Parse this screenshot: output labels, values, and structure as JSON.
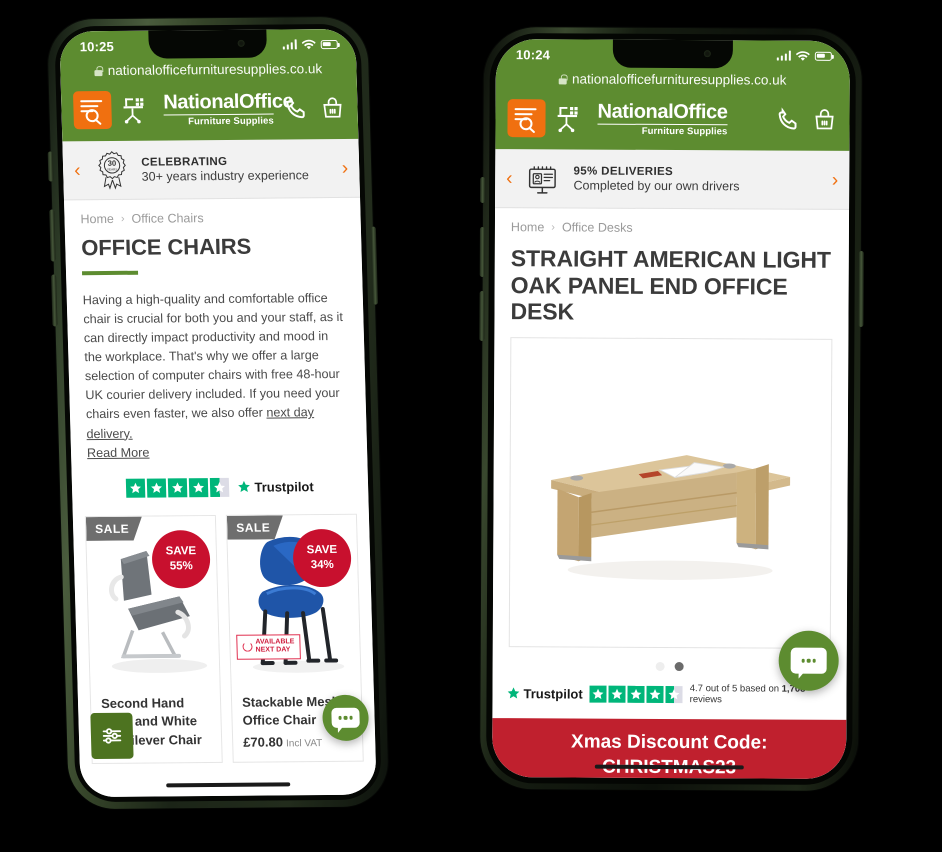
{
  "background_color": "#000000",
  "brand": {
    "green": "#5d8c30",
    "orange": "#f07010",
    "red": "#c8102e",
    "trustpilot_green": "#00b67a",
    "name_part1": "National",
    "name_part2": "Office",
    "tagline": "Furniture Supplies"
  },
  "phones": [
    {
      "id": "left",
      "frame_color": "#3a4a2e",
      "status": {
        "time": "10:25",
        "signal_icon": "signal-bars-icon",
        "wifi_icon": "wifi-icon",
        "battery_icon": "battery-icon"
      },
      "browser": {
        "url": "nationalofficefurnituresupplies.co.uk",
        "lock_icon": "lock-icon"
      },
      "header": {
        "menu_icon": "menu-search-icon",
        "logo_icon": "desk-chair-logo-icon",
        "phone_icon": "phone-icon",
        "basket_icon": "basket-icon"
      },
      "promo": {
        "prev_icon": "chevron-left-icon",
        "next_icon": "chevron-right-icon",
        "badge_icon": "thirty-years-badge-icon",
        "badge_number": "30",
        "badge_caption": "YEARS",
        "title": "CELEBRATING",
        "subtitle": "30+ years industry experience"
      },
      "breadcrumb": {
        "home": "Home",
        "separator": "›",
        "current": "Office Chairs"
      },
      "page_title": "OFFICE CHAIRS",
      "intro_text": "Having a high-quality and comfortable office chair is crucial for both you and your staff, as it can directly impact productivity and mood in the workplace. That's why we offer a large selection of computer chairs with free 48-hour UK courier delivery included. If you need your chairs even faster, we also offer ",
      "intro_link": "next day delivery.",
      "read_more": "Read More",
      "trustpilot": {
        "brand": "Trustpilot",
        "stars": 4.5
      },
      "products": [
        {
          "sale_label": "SALE",
          "save_label": "SAVE",
          "save_value": "55%",
          "image_icon": "grey-cantilever-chair-image",
          "name": "Second Hand Grey and White Cantilever Chair",
          "price": "",
          "vat_note": "",
          "next_day": false
        },
        {
          "sale_label": "SALE",
          "save_label": "SAVE",
          "save_value": "34%",
          "image_icon": "blue-stackable-chair-image",
          "name": "Stackable Mesh Office Chair",
          "price": "£70.80",
          "vat_note": "Incl VAT",
          "next_day": true,
          "next_day_line1": "AVAILABLE",
          "next_day_line2": "NEXT DAY"
        }
      ],
      "filter_button_icon": "filter-sliders-icon",
      "chat_button_icon": "chat-bubble-icon"
    },
    {
      "id": "right",
      "frame_color": "#11160e",
      "status": {
        "time": "10:24",
        "signal_icon": "signal-bars-icon",
        "wifi_icon": "wifi-icon",
        "battery_icon": "battery-icon"
      },
      "browser": {
        "url": "nationalofficefurnituresupplies.co.uk",
        "lock_icon": "lock-icon"
      },
      "header": {
        "menu_icon": "menu-search-icon",
        "logo_icon": "desk-chair-logo-icon",
        "phone_icon": "phone-icon",
        "basket_icon": "basket-icon"
      },
      "promo": {
        "prev_icon": "chevron-left-icon",
        "next_icon": "chevron-right-icon",
        "badge_icon": "delivery-driver-badge-icon",
        "title": "95% DELIVERIES",
        "subtitle": "Completed by our own drivers"
      },
      "breadcrumb": {
        "home": "Home",
        "separator": "›",
        "current": "Office Desks"
      },
      "page_title": "STRAIGHT AMERICAN LIGHT OAK PANEL END OFFICE DESK",
      "gallery": {
        "image_icon": "light-oak-panel-end-desk-image",
        "dots_total": 2,
        "dots_active_index": 1
      },
      "trustpilot": {
        "brand": "Trustpilot",
        "stars": 4.5,
        "summary_prefix": "4.7 out of 5 based on ",
        "summary_count": "1,708",
        "summary_suffix": " reviews"
      },
      "xmas_banner": {
        "line1": "Xmas Discount Code:",
        "line2": "CHRISTMAS23"
      },
      "chat_button_icon": "chat-bubble-icon"
    }
  ]
}
